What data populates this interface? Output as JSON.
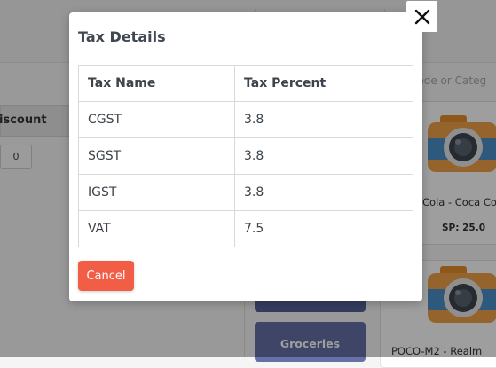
{
  "modal": {
    "title": "Tax Details",
    "columns": [
      "Tax Name",
      "Tax Percent"
    ],
    "rows": [
      {
        "name": "CGST",
        "percent": "3.8"
      },
      {
        "name": "SGST",
        "percent": "3.8"
      },
      {
        "name": "IGST",
        "percent": "3.8"
      },
      {
        "name": "VAT",
        "percent": "7.5"
      }
    ],
    "cancel_label": "Cancel",
    "close_icon": "close-icon"
  },
  "background": {
    "discount_header": "iscount",
    "discount_value": "0",
    "search_placeholder": "Code or Categ",
    "category_button": "Groceries",
    "products": [
      {
        "name": "Cola - Coca Co",
        "price": "SP: 25.0",
        "icon": "camera-icon"
      },
      {
        "name": "POCO-M2 - Realm",
        "icon": "camera-icon"
      }
    ]
  },
  "colors": {
    "accent_cancel": "#f25d45",
    "category_button": "#6470a6",
    "camera_body": "#f0a24a",
    "camera_lens": "#4b90c8"
  }
}
